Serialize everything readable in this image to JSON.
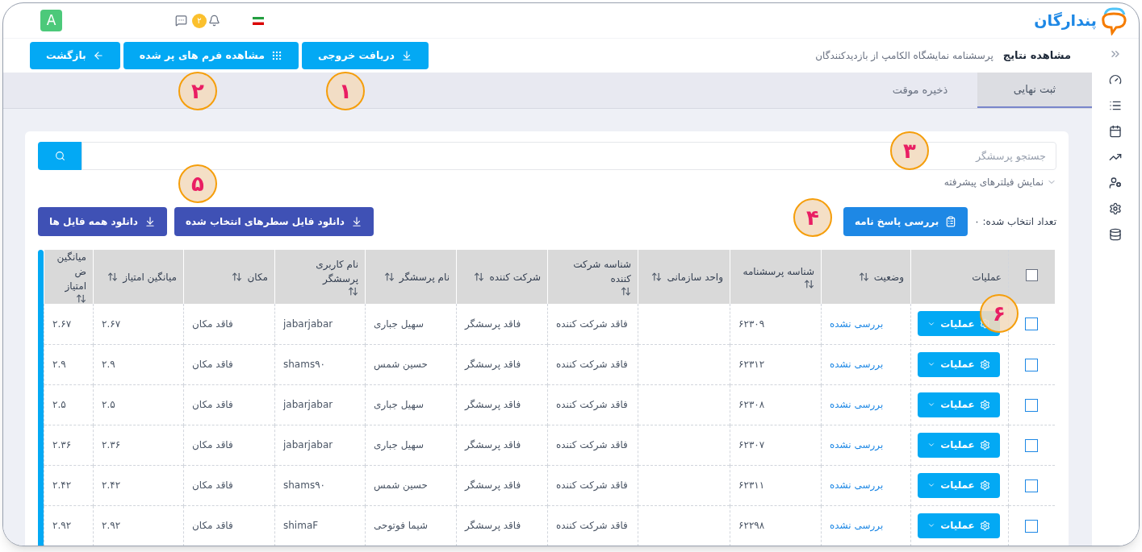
{
  "header": {
    "brand": "پندارگان",
    "avatar_letter": "A",
    "notification_count": "۲"
  },
  "title_bar": {
    "title": "مشاهده نتایج",
    "subtitle": "پرسشنامه نمایشگاه الکامپ از بازدیدکنندگان",
    "buttons": [
      {
        "kind": "export",
        "label": "دریافت خروجی"
      },
      {
        "kind": "forms",
        "label": "مشاهده فرم های پر شده"
      },
      {
        "kind": "back",
        "label": "بازگشت"
      }
    ]
  },
  "tabs": [
    {
      "label": "ثبت نهایی",
      "selected": true
    },
    {
      "label": "ذخیره موقت",
      "selected": false
    }
  ],
  "search": {
    "placeholder": "جستجو پرسشگر"
  },
  "advanced_filters": "نمایش فیلترهای پیشرفته",
  "selected_count": "تعداد انتخاب شده: ۰",
  "review_button": "بررسی پاسخ نامه",
  "download_buttons": [
    "دانلود فایل سطرهای انتخاب شده",
    "دانلود همه فایل ها"
  ],
  "table": {
    "select_all_checked": false,
    "columns": [
      {
        "label": "عملیات",
        "sortable": false,
        "kind": "actions"
      },
      {
        "label": "وضعیت",
        "sortable": true,
        "kind": "status"
      },
      {
        "label": "شناسه پرسشنامه",
        "sortable": true
      },
      {
        "label": "واحد سازمانی",
        "sortable": true
      },
      {
        "label": "شناسه شرکت کننده",
        "sortable": true
      },
      {
        "label": "شرکت کننده",
        "sortable": true
      },
      {
        "label": "نام پرسشگر",
        "sortable": true
      },
      {
        "label": "نام کاربری پرسشگر",
        "sortable": true
      },
      {
        "label": "مکان",
        "sortable": true
      },
      {
        "label": "میانگین امتیاز",
        "sortable": true
      },
      {
        "label": "میانگین ض امتیاز",
        "sortable": true
      }
    ],
    "rows": [
      {
        "checked": false,
        "cells": [
          "عملیات",
          "بررسی نشده",
          "۶۲۳۰۹",
          "",
          "فاقد شرکت کننده",
          "فاقد پرسشگر",
          "سهیل جباری",
          "jabarjabar",
          "فاقد مکان",
          "۲.۶۷",
          "۲.۶۷"
        ]
      },
      {
        "checked": false,
        "cells": [
          "عملیات",
          "بررسی نشده",
          "۶۲۳۱۲",
          "",
          "فاقد شرکت کننده",
          "فاقد پرسشگر",
          "حسین شمس",
          "shams۹۰",
          "فاقد مکان",
          "۲.۹",
          "۲.۹"
        ]
      },
      {
        "checked": false,
        "cells": [
          "عملیات",
          "بررسی نشده",
          "۶۲۳۰۸",
          "",
          "فاقد شرکت کننده",
          "فاقد پرسشگر",
          "سهیل جباری",
          "jabarjabar",
          "فاقد مکان",
          "۲.۵",
          "۲.۵"
        ]
      },
      {
        "checked": false,
        "cells": [
          "عملیات",
          "بررسی نشده",
          "۶۲۳۰۷",
          "",
          "فاقد شرکت کننده",
          "فاقد پرسشگر",
          "سهیل جباری",
          "jabarjabar",
          "فاقد مکان",
          "۲.۳۶",
          "۲.۳۶"
        ]
      },
      {
        "checked": false,
        "cells": [
          "عملیات",
          "بررسی نشده",
          "۶۲۳۱۱",
          "",
          "فاقد شرکت کننده",
          "فاقد پرسشگر",
          "حسین شمس",
          "shams۹۰",
          "فاقد مکان",
          "۲.۴۲",
          "۲.۴۲"
        ]
      },
      {
        "checked": false,
        "cells": [
          "عملیات",
          "بررسی نشده",
          "۶۲۲۹۸",
          "",
          "فاقد شرکت کننده",
          "فاقد پرسشگر",
          "شیما فوتوحی",
          "shimaF",
          "فاقد مکان",
          "۲.۹۲",
          "۲.۹۲"
        ]
      }
    ]
  },
  "callouts": [
    "۱",
    "۲",
    "۳",
    "۴",
    "۵",
    "۶"
  ]
}
